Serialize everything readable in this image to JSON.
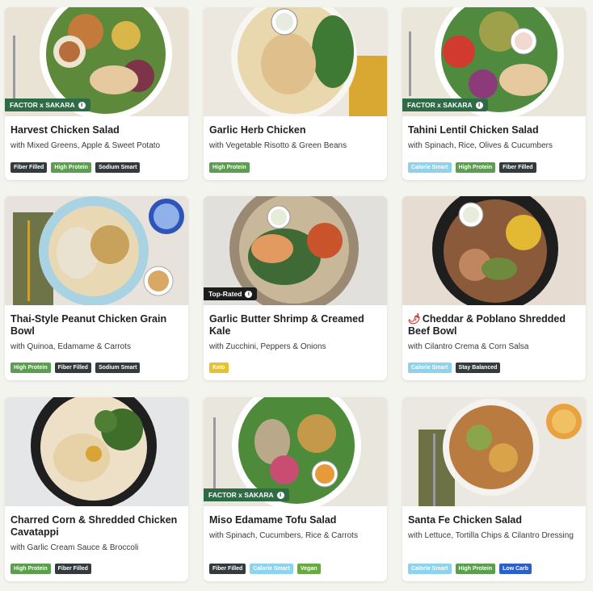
{
  "cards": [
    {
      "title": "Harvest Chicken Salad",
      "subtitle": "with Mixed Greens, Apple & Sweet Potato",
      "badge": "FACTOR x SAKARA",
      "tags": [
        "Fiber Filled",
        "High Protein",
        "Sodium Smart"
      ]
    },
    {
      "title": "Garlic Herb Chicken",
      "subtitle": "with Vegetable Risotto & Green Beans",
      "badge": "",
      "tags": [
        "High Protein"
      ]
    },
    {
      "title": "Tahini Lentil Chicken Salad",
      "subtitle": "with Spinach, Rice, Olives & Cucumbers",
      "badge": "FACTOR x SAKARA",
      "tags": [
        "Calorie Smart",
        "High Protein",
        "Fiber Filled"
      ]
    },
    {
      "title": "Thai-Style Peanut Chicken Grain Bowl",
      "subtitle": "with Quinoa, Edamame & Carrots",
      "badge": "",
      "tags": [
        "High Protein",
        "Fiber Filled",
        "Sodium Smart"
      ]
    },
    {
      "title": "Garlic Butter Shrimp & Creamed Kale",
      "subtitle": "with Zucchini, Peppers & Onions",
      "badge": "Top-Rated",
      "tags": [
        "Keto"
      ]
    },
    {
      "title": "Cheddar & Poblano Shredded Beef Bowl",
      "subtitle": "with Cilantro Crema & Corn Salsa",
      "badge": "",
      "tags": [
        "Calorie Smart",
        "Stay Balanced"
      ]
    },
    {
      "title": "Charred Corn & Shredded Chicken Cavatappi",
      "subtitle": "with Garlic Cream Sauce & Broccoli",
      "badge": "",
      "tags": [
        "High Protein",
        "Fiber Filled"
      ]
    },
    {
      "title": "Miso Edamame Tofu Salad",
      "subtitle": "with Spinach, Cucumbers, Rice & Carrots",
      "badge": "FACTOR x SAKARA",
      "tags": [
        "Fiber Filled",
        "Calorie Smart",
        "Vegan"
      ]
    },
    {
      "title": "Santa Fe Chicken Salad",
      "subtitle": "with Lettuce, Tortilla Chips & Cilantro Dressing",
      "badge": "",
      "tags": [
        "Calorie Smart",
        "High Protein",
        "Low Carb"
      ]
    }
  ],
  "colors": {
    "fiber_filled": "#333b3f",
    "high_protein": "#5c9d4f",
    "sodium_smart": "#333b3f",
    "calorie_smart": "#8ed3ee",
    "stay_balanced": "#333b3f",
    "keto": "#e8c12d",
    "vegan": "#6aa844",
    "low_carb": "#2c5fc8",
    "factor_badge": "#2f6b46",
    "top_rated_badge": "#1c1c1c"
  },
  "icons": {
    "badge_info": "info-icon",
    "spicy": "chili-pepper-icon"
  }
}
